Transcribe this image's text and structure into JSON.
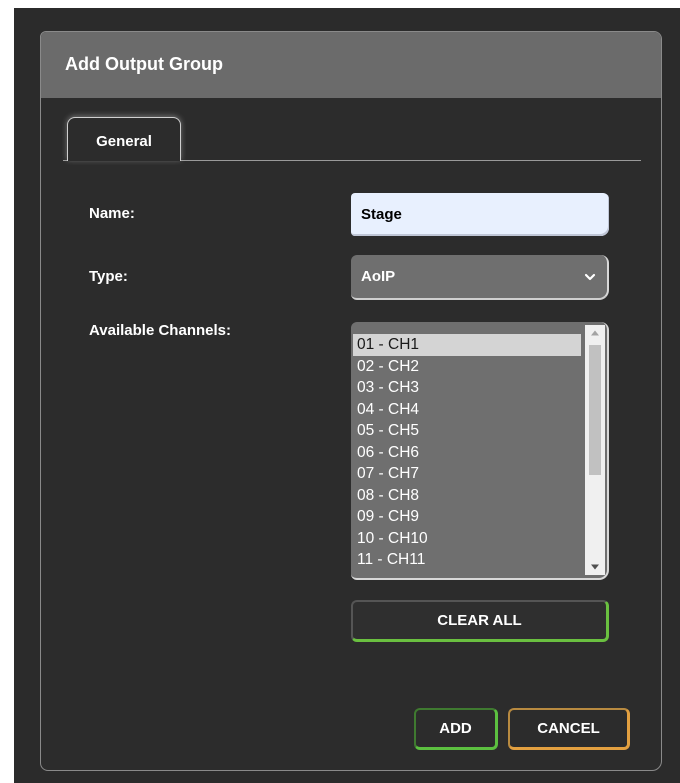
{
  "dialog": {
    "title": "Add Output Group"
  },
  "tabs": [
    {
      "label": "General",
      "active": true
    }
  ],
  "form": {
    "name_label": "Name:",
    "name_value": "Stage",
    "type_label": "Type:",
    "type_value": "AoIP",
    "channels_label": "Available Channels:",
    "channels": [
      "01 - CH1",
      "02 - CH2",
      "03 - CH3",
      "04 - CH4",
      "05 - CH5",
      "06 - CH6",
      "07 - CH7",
      "08 - CH8",
      "09 - CH9",
      "10 - CH10",
      "11 - CH11"
    ],
    "selected_channel": "01 - CH1"
  },
  "buttons": {
    "clear_all": "CLEAR ALL",
    "add": "ADD",
    "cancel": "CANCEL"
  },
  "icons": {
    "type_dropdown": "chevron-down-icon",
    "scroll_up": "scroll-up-arrow-icon",
    "scroll_down": "scroll-down-arrow-icon"
  },
  "colors": {
    "titlebar": "#6b6b6b",
    "dialog_bg": "#2c2c2c",
    "add_accent": "#5cc040",
    "cancel_accent": "#e3a040",
    "clear_accent": "#6ac040",
    "name_input_bg": "#e8f0fe"
  }
}
